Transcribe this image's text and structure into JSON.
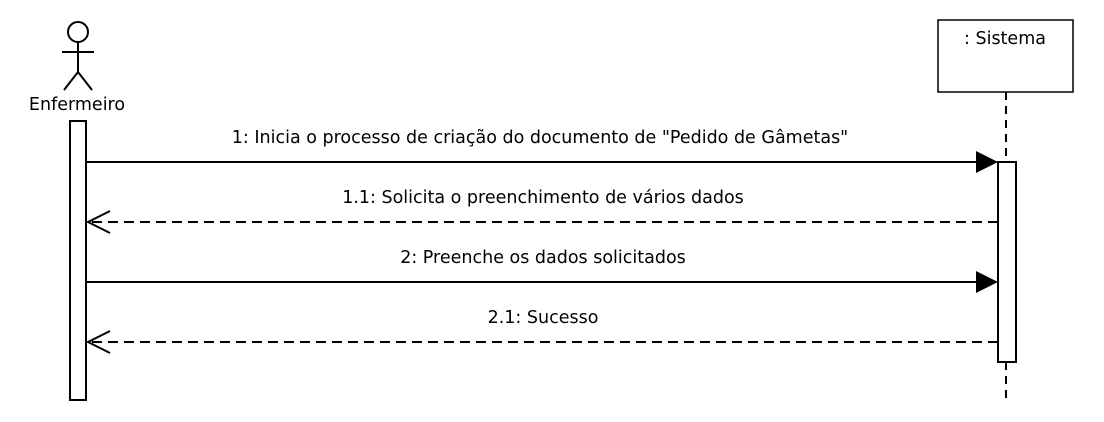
{
  "actor": {
    "name": "Enfermeiro",
    "icon": "stick-figure-actor"
  },
  "system": {
    "name": ": Sistema"
  },
  "messages": [
    {
      "label": "1: Inicia o processo de criação do documento de \"Pedido de Gâmetas\"",
      "kind": "synchronous",
      "direction": "actor-to-system"
    },
    {
      "label": "1.1: Solicita o preenchimento de vários dados",
      "kind": "reply",
      "direction": "system-to-actor"
    },
    {
      "label": "2: Preenche os dados solicitados",
      "kind": "synchronous",
      "direction": "actor-to-system"
    },
    {
      "label": "2.1: Sucesso",
      "kind": "reply",
      "direction": "system-to-actor"
    }
  ],
  "colors": {
    "stroke": "#000000",
    "background": "#ffffff"
  }
}
